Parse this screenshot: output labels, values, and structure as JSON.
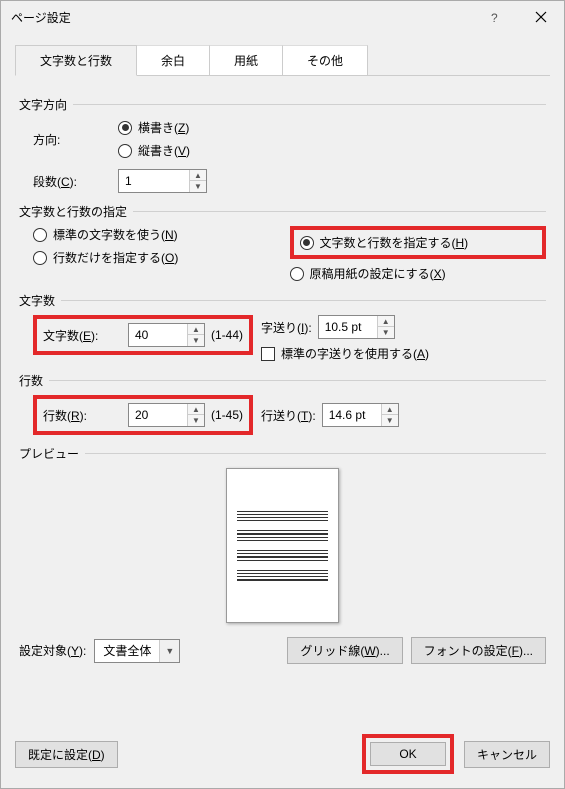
{
  "title": "ページ設定",
  "tabs": {
    "t1": "文字数と行数",
    "t2": "余白",
    "t3": "用紙",
    "t4": "その他"
  },
  "direction": {
    "group": "文字方向",
    "label": "方向:",
    "horiz": "横書き(",
    "horiz_k": "Z",
    "horiz_e": ")",
    "vert": "縦書き(",
    "vert_k": "V",
    "vert_e": ")"
  },
  "columns_label": "段数(",
  "columns_k": "C",
  "columns_e": "):",
  "columns_val": "1",
  "spec": {
    "group": "文字数と行数の指定",
    "std": "標準の文字数を使う(",
    "std_k": "N",
    "std_e": ")",
    "rowsonly": "行数だけを指定する(",
    "rowsonly_k": "O",
    "rowsonly_e": ")",
    "both": "文字数と行数を指定する(",
    "both_k": "H",
    "both_e": ")",
    "grid": "原稿用紙の設定にする(",
    "grid_k": "X",
    "grid_e": ")"
  },
  "chars": {
    "group": "文字数",
    "label": "文字数(",
    "label_k": "E",
    "label_e": "):",
    "val": "40",
    "range": "(1-44)",
    "pitch_label": "字送り(",
    "pitch_k": "I",
    "pitch_e": "):",
    "pitch_val": "10.5 pt",
    "std_pitch": "標準の字送りを使用する(",
    "std_pitch_k": "A",
    "std_pitch_e": ")"
  },
  "lines": {
    "group": "行数",
    "label": "行数(",
    "label_k": "R",
    "label_e": "):",
    "val": "20",
    "range": "(1-45)",
    "pitch_label": "行送り(",
    "pitch_k": "T",
    "pitch_e": "):",
    "pitch_val": "14.6 pt"
  },
  "preview": "プレビュー",
  "apply_to_label": "設定対象(",
  "apply_to_k": "Y",
  "apply_to_e": "):",
  "apply_to_val": "文書全体",
  "gridlines_btn": "グリッド線(",
  "gridlines_k": "W",
  "gridlines_e": ")...",
  "font_btn": "フォントの設定(",
  "font_k": "F",
  "font_e": ")...",
  "default_btn": "既定に設定(",
  "default_k": "D",
  "default_e": ")",
  "ok": "OK",
  "cancel": "キャンセル"
}
